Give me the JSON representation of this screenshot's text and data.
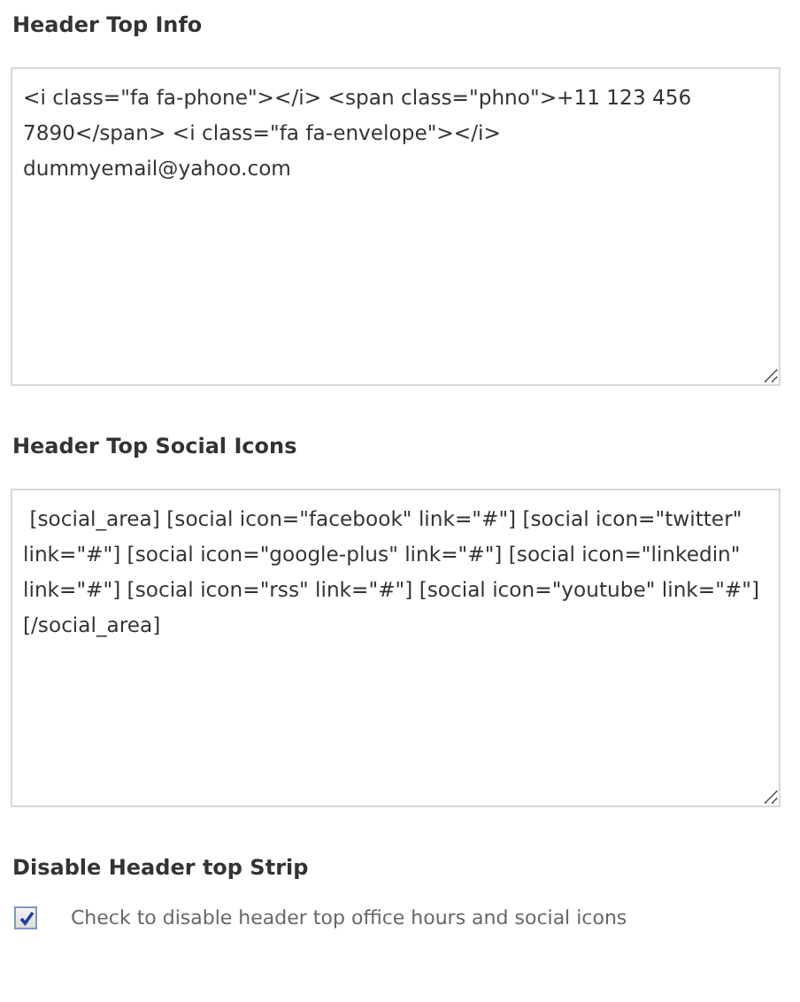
{
  "fields": [
    {
      "kind": "textarea",
      "label": "Header Top Info",
      "value": "<i class=\"fa fa-phone\"></i> <span class=\"phno\">+11 123 456 7890</span> <i class=\"fa fa-envelope\"></i> dummyemail@yahoo.com"
    },
    {
      "kind": "textarea",
      "label": "Header Top Social Icons",
      "value": " [social_area] [social icon=\"facebook\" link=\"#\"] [social icon=\"twitter\" link=\"#\"] [social icon=\"google-plus\" link=\"#\"] [social icon=\"linkedin\" link=\"#\"] [social icon=\"rss\" link=\"#\"] [social icon=\"youtube\" link=\"#\"] [/social_area]"
    },
    {
      "kind": "checkbox",
      "label": "Disable Header top Strip",
      "description": "Check to disable header top office hours and social icons",
      "checked": true
    }
  ]
}
